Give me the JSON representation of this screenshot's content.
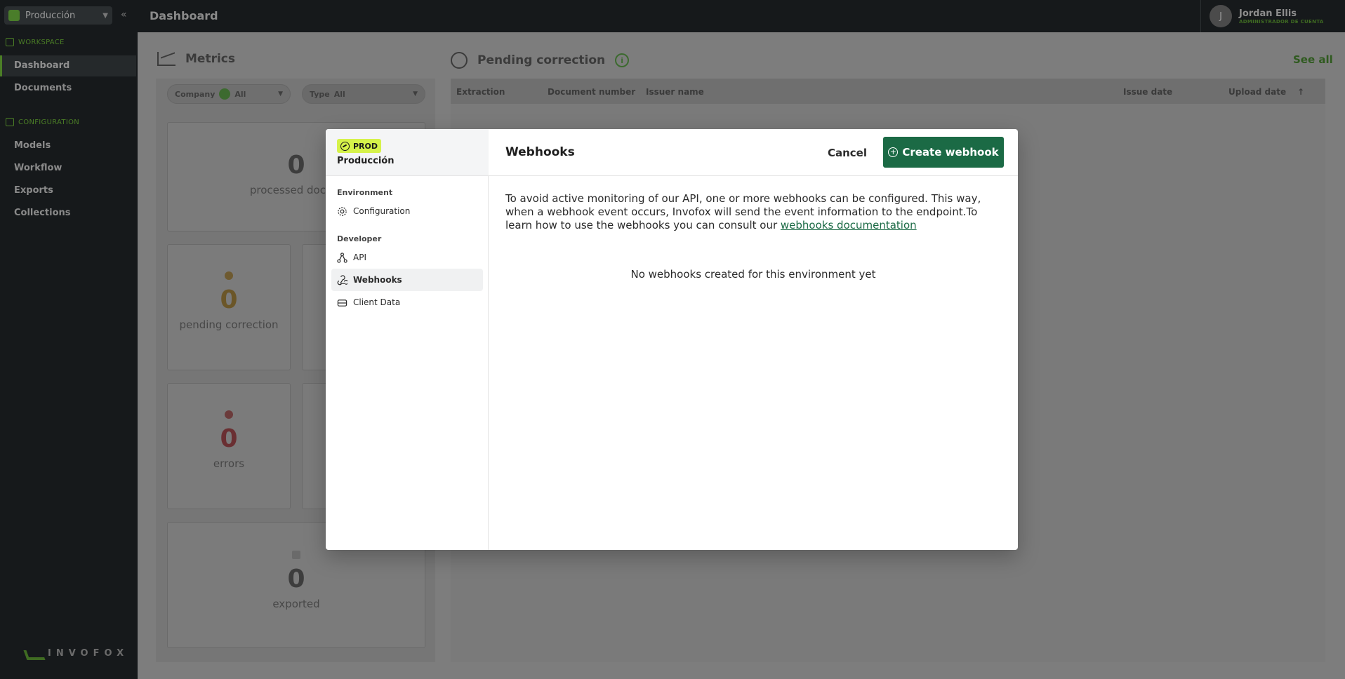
{
  "topbar": {
    "env_select": "Producción",
    "page_title": "Dashboard",
    "user": {
      "initial": "J",
      "name": "Jordan Ellis",
      "role": "ADMINISTRADOR DE CUENTA"
    }
  },
  "sidebar": {
    "workspace_label": "WORKSPACE",
    "workspace_items": [
      "Dashboard",
      "Documents"
    ],
    "config_label": "CONFIGURATION",
    "config_items": [
      "Models",
      "Workflow",
      "Exports",
      "Collections"
    ],
    "brand": "INVOFOX"
  },
  "metrics": {
    "title": "Metrics",
    "company_label": "Company",
    "company_value": "All",
    "type_label": "Type",
    "type_value": "All",
    "cards": [
      {
        "value": "0",
        "label": "processed docum"
      },
      {
        "value": "0",
        "label": "pending correction"
      },
      {
        "value": "0",
        "label": "errors"
      },
      {
        "value": "0",
        "label": "exported"
      }
    ]
  },
  "pending": {
    "title": "Pending correction",
    "see_all": "See all",
    "columns": [
      "Extraction",
      "Document number",
      "Issuer name",
      "Issue date",
      "Upload date"
    ]
  },
  "modal": {
    "env_badge": "PROD",
    "env_name": "Producción",
    "groups": {
      "environment": "Environment",
      "developer": "Developer"
    },
    "items": {
      "configuration": "Configuration",
      "api": "API",
      "webhooks": "Webhooks",
      "client_data": "Client Data"
    },
    "title": "Webhooks",
    "cancel": "Cancel",
    "create": "Create webhook",
    "description": "To avoid active monitoring of our API, one or more webhooks can be configured. This way, when a webhook event occurs, Invofox will send the event information to the endpoint.To learn how to use the webhooks you can consult our ",
    "doc_link": "webhooks documentation",
    "empty": "No webhooks created for this environment yet"
  },
  "colors": {
    "accent": "#1b6a45",
    "badge": "#d6f24a"
  }
}
